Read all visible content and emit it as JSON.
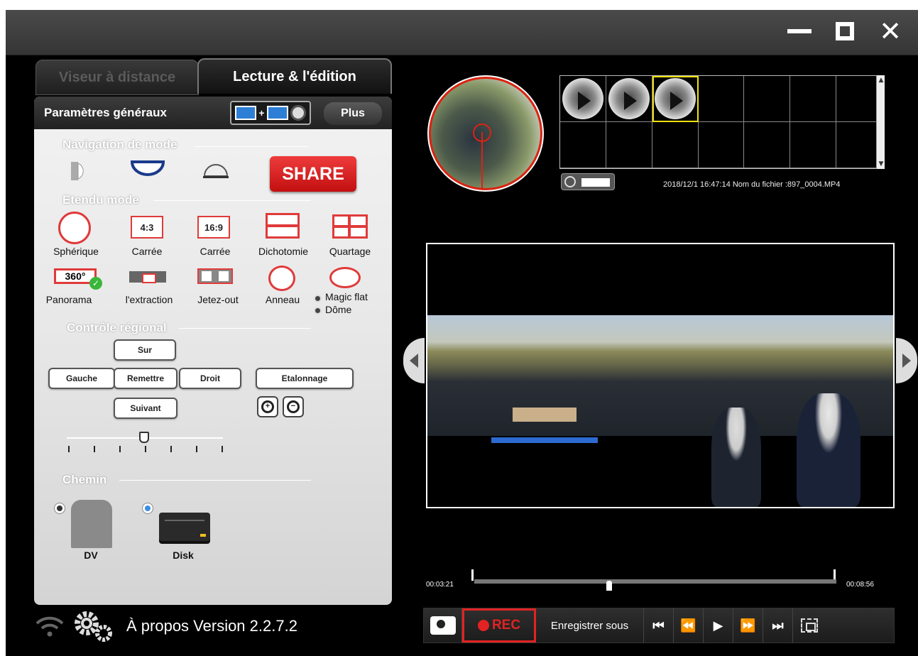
{
  "tabs": [
    {
      "label": "Viseur à distance",
      "active": false
    },
    {
      "label": "Lecture & l'édition",
      "active": true
    }
  ],
  "panel": {
    "title": "Paramètres généraux",
    "plus_label": "Plus",
    "share_label": "SHARE",
    "sections": {
      "navigation": "Navigation de mode",
      "extended": "Etendu mode",
      "regional": "Contrôle régional",
      "path": "Chemin"
    },
    "extended_modes": [
      {
        "label": "Sphérique"
      },
      {
        "label": "Carrée",
        "badge": "4:3"
      },
      {
        "label": "Carrée",
        "badge": "16:9"
      },
      {
        "label": "Dichotomie"
      },
      {
        "label": "Quartage"
      },
      {
        "label": "Panorama",
        "badge": "360°",
        "selected": true
      },
      {
        "label": "l'extraction"
      },
      {
        "label": "Jetez-out"
      },
      {
        "label": "Anneau"
      }
    ],
    "magic_options": [
      "Magic flat",
      "Dôme"
    ],
    "regional_buttons": {
      "up": "Sur",
      "left": "Gauche",
      "reset": "Remettre",
      "right": "Droit",
      "down": "Suivant",
      "calibrate": "Etalonnage"
    },
    "slider_value_fraction": 0.46,
    "paths": [
      {
        "label": "DV",
        "selected": false
      },
      {
        "label": "Disk",
        "selected": true
      }
    ]
  },
  "footer": {
    "about": "À propos Version 2.2.7.2"
  },
  "playlist": {
    "file_info": "2018/12/1 16:47:14 Nom du fichier :897_0004.MP4",
    "thumbnail_count": 3,
    "selected_index": 2
  },
  "player": {
    "time_start": "00:03:21",
    "time_end": "00:08:56",
    "rec_label": "REC",
    "save_as_label": "Enregistrer sous"
  },
  "colors": {
    "accent_red": "#e32222",
    "share_red": "#d42020",
    "selected_yellow": "#f0e010",
    "disk_radio_blue": "#3a8ee0"
  }
}
